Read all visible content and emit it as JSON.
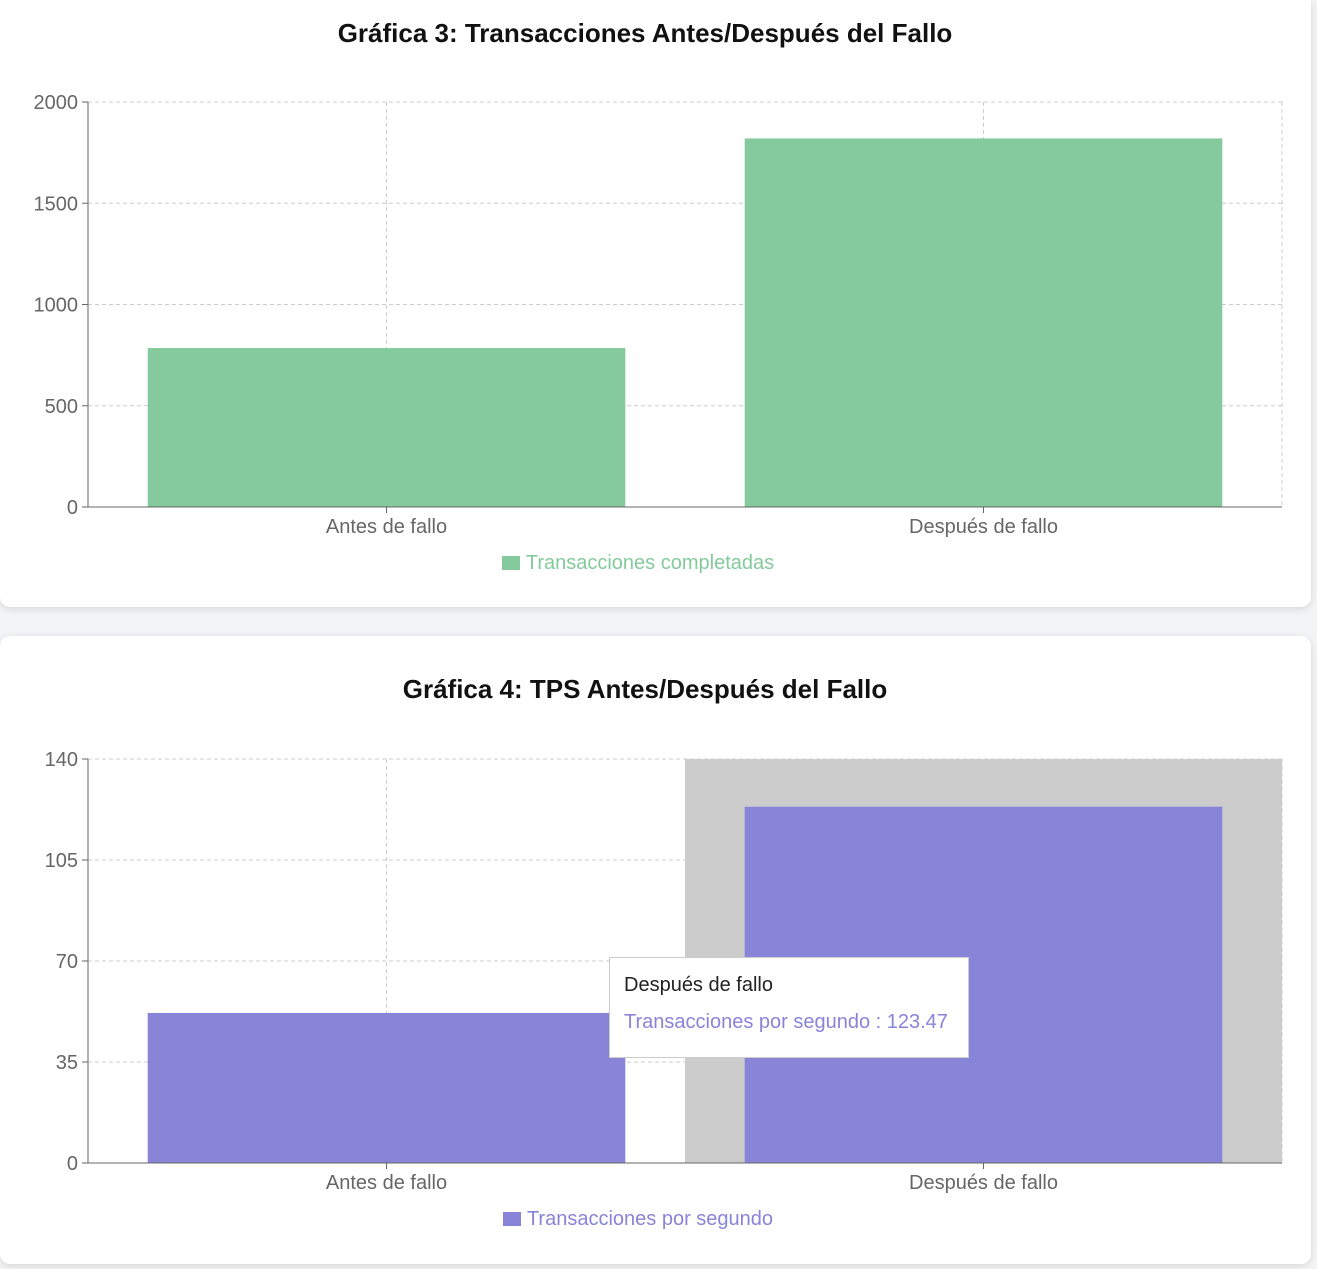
{
  "charts": [
    {
      "id": "chart3",
      "title": "Gráfica 3: Transacciones Antes/Después del Fallo",
      "color": "#84ca9c",
      "legend_label": "Transacciones completadas",
      "y_ticks": [
        "0",
        "500",
        "1000",
        "1500",
        "2000"
      ]
    },
    {
      "id": "chart4",
      "title": "Gráfica 4: TPS Antes/Después del Fallo",
      "color": "#8884d8",
      "legend_label": "Transacciones por segundo",
      "y_ticks": [
        "0",
        "35",
        "70",
        "105",
        "140"
      ],
      "tooltip": {
        "title": "Después de fallo",
        "series_label": "Transacciones por segundo",
        "separator": " : ",
        "value": "123.47",
        "active_category": "Después de fallo"
      }
    }
  ],
  "chart_data": [
    {
      "type": "bar",
      "title": "Gráfica 3: Transacciones Antes/Después del Fallo",
      "categories": [
        "Antes de fallo",
        "Después de fallo"
      ],
      "series": [
        {
          "name": "Transacciones completadas",
          "values": [
            785,
            1820
          ],
          "color": "#84ca9c"
        }
      ],
      "xlabel": "",
      "ylabel": "",
      "ylim": [
        0,
        2000
      ],
      "yticks": [
        0,
        500,
        1000,
        1500,
        2000
      ],
      "grid": true,
      "legend_position": "bottom"
    },
    {
      "type": "bar",
      "title": "Gráfica 4: TPS Antes/Después del Fallo",
      "categories": [
        "Antes de fallo",
        "Después de fallo"
      ],
      "series": [
        {
          "name": "Transacciones por segundo",
          "values": [
            52,
            123.47
          ],
          "color": "#8884d8"
        }
      ],
      "xlabel": "",
      "ylabel": "",
      "ylim": [
        0,
        140
      ],
      "yticks": [
        0,
        35,
        70,
        105,
        140
      ],
      "grid": true,
      "legend_position": "bottom",
      "highlighted_category": "Después de fallo"
    }
  ]
}
